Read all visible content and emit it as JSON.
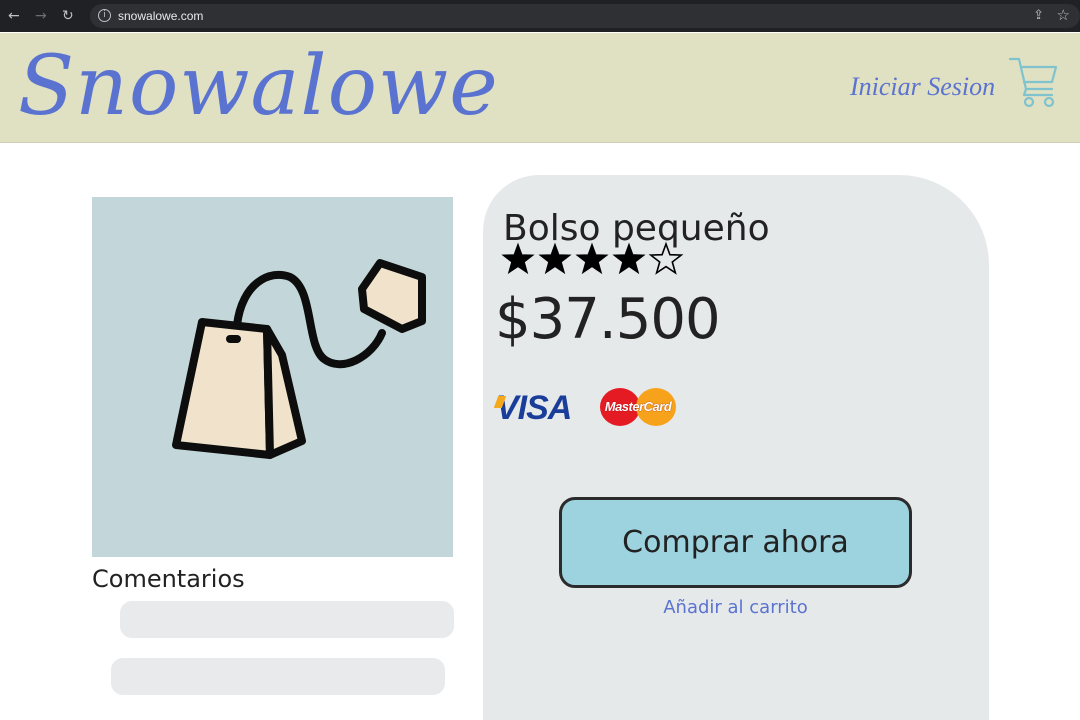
{
  "browser": {
    "url": "snowalowe.com"
  },
  "header": {
    "logo": "Snowalowe",
    "login_label": "Iniciar Sesion"
  },
  "product": {
    "title": "Bolso pequeño",
    "rating": 4,
    "rating_max": 5,
    "price": "$37.500",
    "payment_methods": {
      "visa": "VISA",
      "mastercard": "MasterCard"
    },
    "buy_label": "Comprar ahora",
    "add_to_cart_label": "Añadir al carrito"
  },
  "comments": {
    "title": "Comentarios"
  },
  "colors": {
    "header_bg": "#e0e0c2",
    "brand_blue": "#5b73d0",
    "image_bg": "#c3d6d9",
    "card_bg": "#e6e9ea",
    "buy_button_bg": "#9dd3df"
  }
}
